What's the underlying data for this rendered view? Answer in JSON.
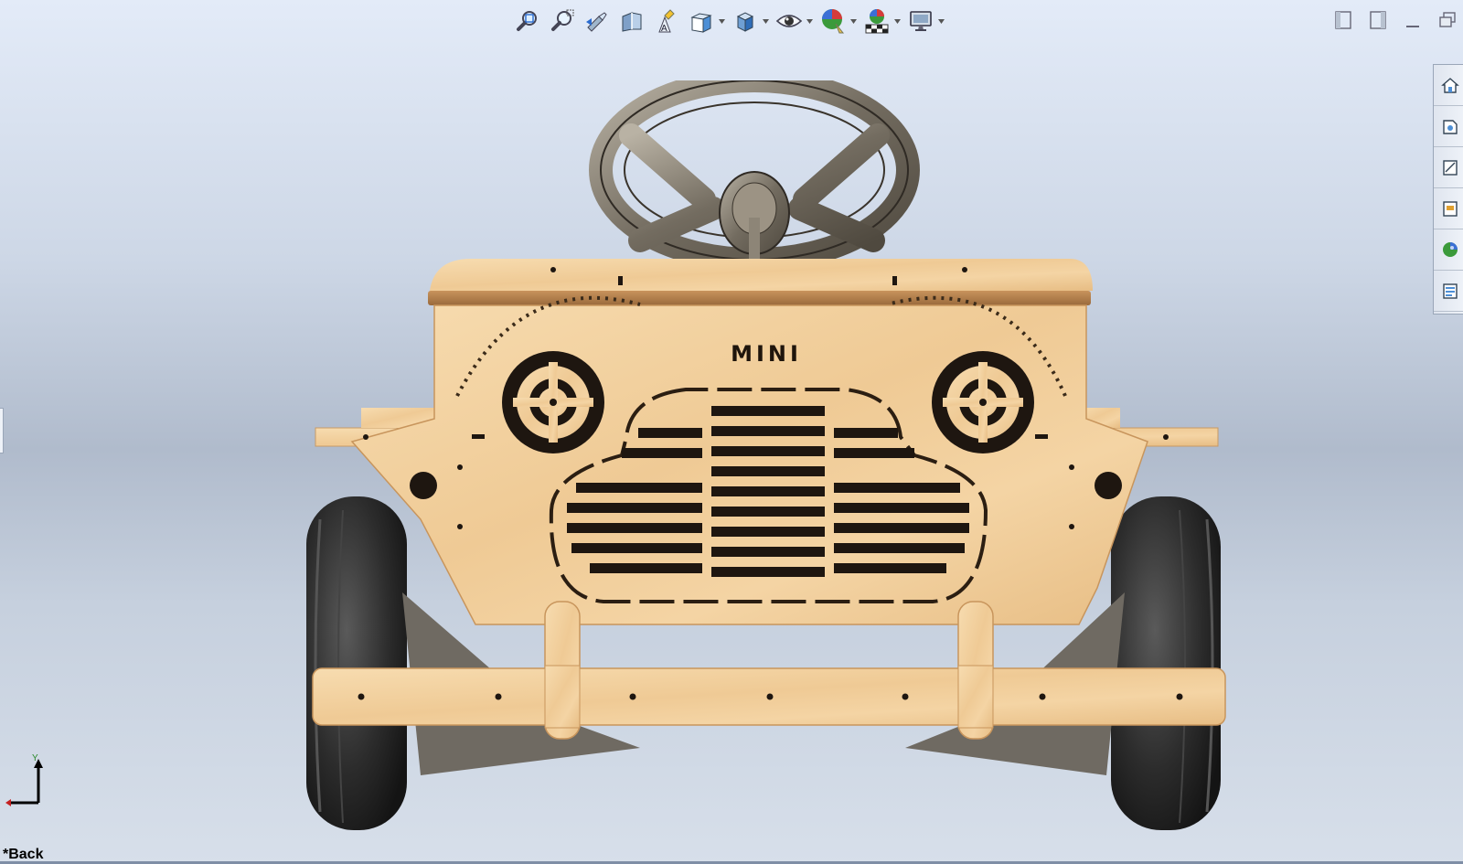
{
  "toolbar": {
    "items": [
      {
        "name": "zoom-to-fit-icon"
      },
      {
        "name": "zoom-to-area-icon"
      },
      {
        "name": "previous-view-icon"
      },
      {
        "name": "section-view-icon"
      },
      {
        "name": "dynamic-annotation-views-icon"
      },
      {
        "name": "view-orientation-icon"
      },
      {
        "name": "display-style-icon"
      },
      {
        "name": "hide-show-items-icon"
      },
      {
        "name": "edit-appearance-icon"
      },
      {
        "name": "apply-scene-icon"
      },
      {
        "name": "view-settings-icon"
      }
    ]
  },
  "window_controls": [
    "tile-left-icon",
    "tile-right-icon",
    "minimize-icon",
    "restore-icon"
  ],
  "task_pane": [
    "home-icon",
    "design-library-icon",
    "file-explorer-icon",
    "view-palette-icon",
    "appearances-icon",
    "custom-properties-icon"
  ],
  "model": {
    "badge_text": "MINI",
    "colors": {
      "wood": "#f2cfa0",
      "wood_dark": "#dcae74",
      "tire": "#2a2a2a",
      "steel": "#8d8577"
    }
  },
  "triad": {
    "y_label": "Y"
  },
  "view": {
    "name": "*Back"
  }
}
